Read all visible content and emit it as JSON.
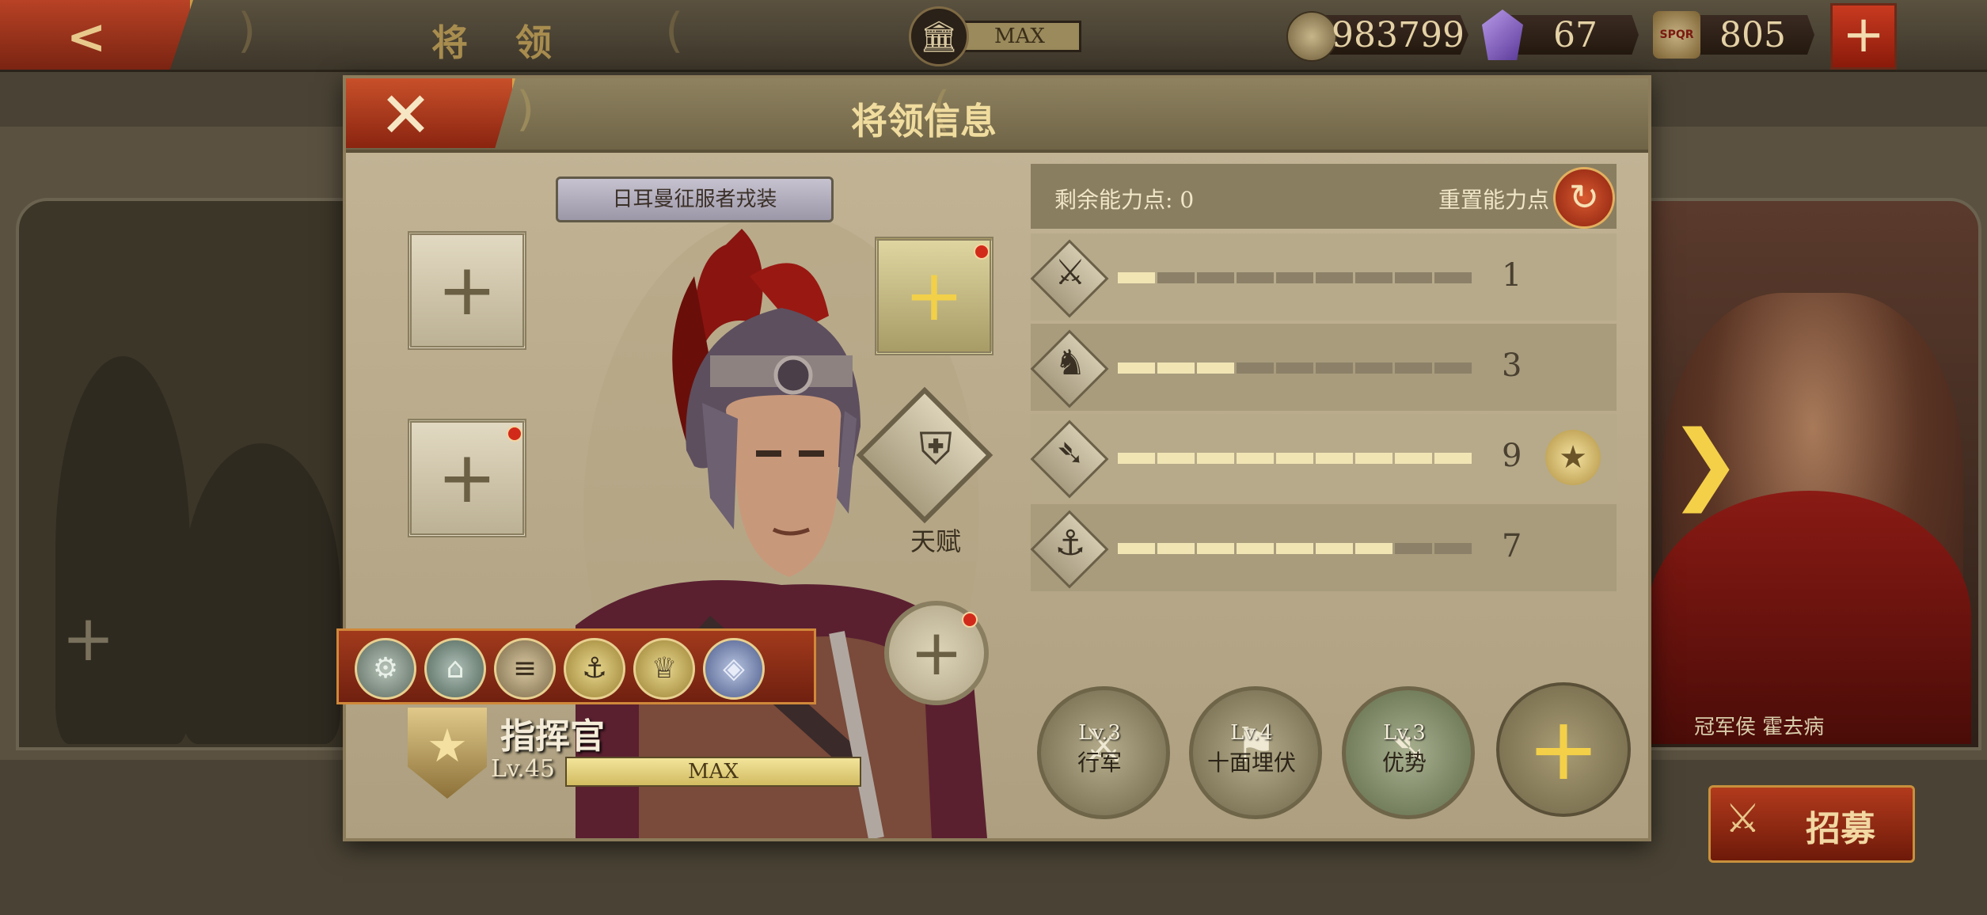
{
  "topbar": {
    "title": "将 领",
    "building_max": "MAX",
    "coins": "983799",
    "gems": "67",
    "spqr": "805",
    "spqr_icon_text": "SPQR",
    "icons": [
      "back-arrow-icon",
      "building-icon",
      "coin-icon",
      "gem-icon",
      "spqr-icon",
      "plus-icon"
    ]
  },
  "dialog": {
    "title": "将领信息",
    "skin_name": "日耳曼征服者戎装",
    "talent_label": "天赋",
    "rank_title": "指挥官",
    "level": "Lv.45",
    "level_bar": "MAX",
    "stats": {
      "remaining_label": "剩余能力点: 0",
      "reset_label": "重置能力点",
      "rows": [
        {
          "icon": "sword-icon",
          "value": "1",
          "max": 9
        },
        {
          "icon": "horse-icon",
          "value": "3",
          "max": 9
        },
        {
          "icon": "bow-icon",
          "value": "9",
          "max": 9
        },
        {
          "icon": "anchor-icon",
          "value": "7",
          "max": 9
        }
      ]
    },
    "troop_skills": [
      {
        "level": "Lv.3",
        "name": "行军"
      },
      {
        "level": "Lv.4",
        "name": "十面埋伏"
      },
      {
        "level": "Lv.3",
        "name": "优势"
      }
    ]
  },
  "right_general": {
    "name": "冠军侯 霍去病"
  },
  "recruit_label": "招募",
  "colors": {
    "accent_red": "#b23a1c",
    "gold": "#f4d048",
    "bar_filled": "#f1e5b4",
    "bar_empty": "#8c8168"
  }
}
